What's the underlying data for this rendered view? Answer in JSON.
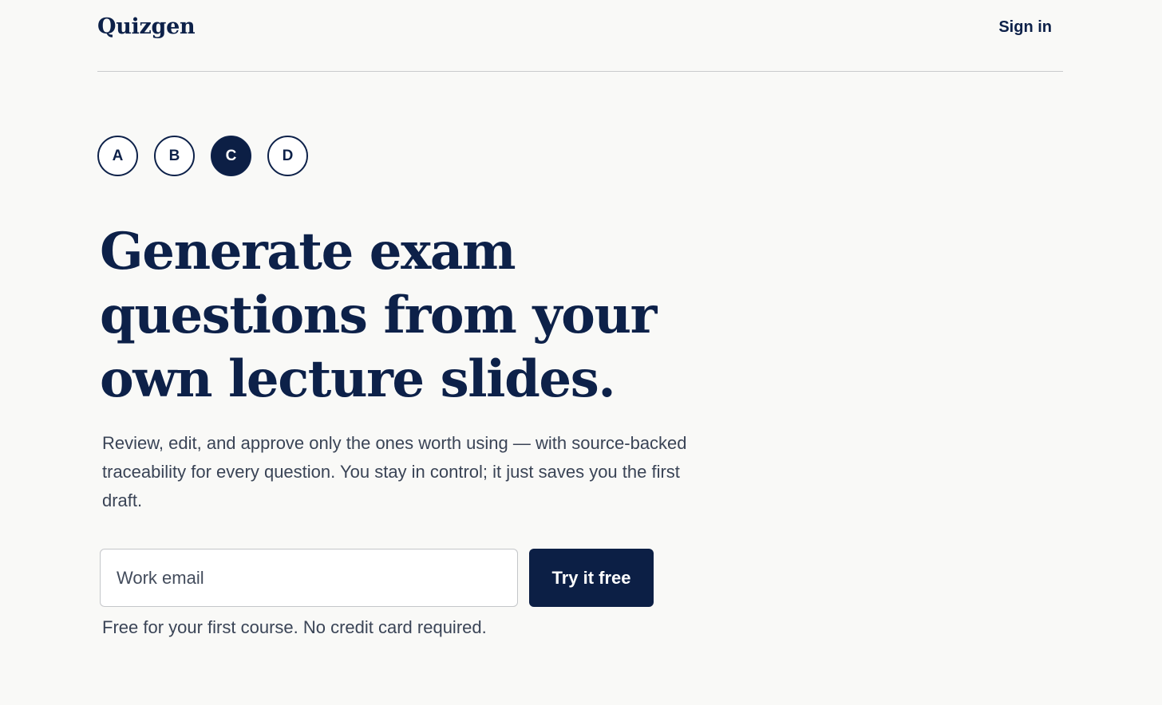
{
  "header": {
    "logo": "Quizgen",
    "sign_in": "Sign in"
  },
  "steps": [
    {
      "label": "A",
      "active": false
    },
    {
      "label": "B",
      "active": false
    },
    {
      "label": "C",
      "active": true
    },
    {
      "label": "D",
      "active": false
    }
  ],
  "hero": {
    "headline_lines": [
      "Generate exam",
      "questions from your",
      "own lecture slides."
    ],
    "subtext": "Review, edit, and approve only the ones worth using — with source-backed traceability for every question. You stay in control; it just saves you the first draft.",
    "email_placeholder": "Work email",
    "cta_label": "Try it free",
    "note": "Free for your first course. No credit card required."
  },
  "colors": {
    "navy": "#0c1f45",
    "background": "#f9f9f7",
    "body_text": "#3a4456"
  }
}
